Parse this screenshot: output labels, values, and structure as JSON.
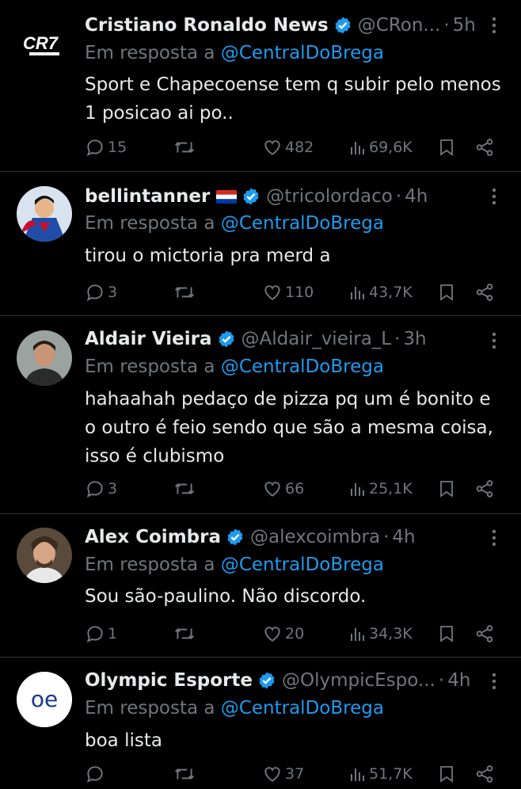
{
  "tweets": [
    {
      "author_name": "Cristiano Ronaldo News",
      "handle": "@CRon...",
      "time": "5h",
      "reply_prefix": "Em resposta a",
      "reply_to": "@CentralDoBrega",
      "lines": [
        "Sport e Chapecoense tem q subir pelo menos",
        "1 posicao ai po.."
      ],
      "replies": "15",
      "likes": "482",
      "views": "69,6K",
      "avatar_label": "CR7"
    },
    {
      "author_name": "bellintanner",
      "handle": "@tricolordaco",
      "time": "4h",
      "reply_prefix": "Em resposta a",
      "reply_to": "@CentralDoBrega",
      "lines": [
        "tirou o mictoria pra merd a"
      ],
      "replies": "3",
      "likes": "110",
      "views": "43,7K"
    },
    {
      "author_name": "Aldair Vieira",
      "handle": "@Aldair_vieira_L",
      "time": "3h",
      "reply_prefix": "Em resposta a",
      "reply_to": "@CentralDoBrega",
      "lines": [
        "hahaahah pedaço de pizza pq um é bonito e",
        "o outro é feio sendo que são a mesma coisa,",
        "isso é clubismo"
      ],
      "replies": "3",
      "likes": "66",
      "views": "25,1K"
    },
    {
      "author_name": "Alex Coimbra",
      "handle": "@alexcoimbra",
      "time": "4h",
      "reply_prefix": "Em resposta a",
      "reply_to": "@CentralDoBrega",
      "lines": [
        "Sou são-paulino. Não discordo."
      ],
      "replies": "1",
      "likes": "20",
      "views": "34,3K"
    },
    {
      "author_name": "Olympic Esporte",
      "handle": "@OlympicEspo...",
      "time": "4h",
      "reply_prefix": "Em resposta a",
      "reply_to": "@CentralDoBrega",
      "lines": [
        "boa lista"
      ],
      "replies": "",
      "likes": "37",
      "views": "51,7K",
      "avatar_label": "oe"
    }
  ],
  "colors": {
    "background": "#000000",
    "text": "#e7e9ea",
    "muted": "#71767b",
    "link": "#1d9bf0",
    "verified": "#1d9bf0",
    "divider": "#2f3336"
  }
}
